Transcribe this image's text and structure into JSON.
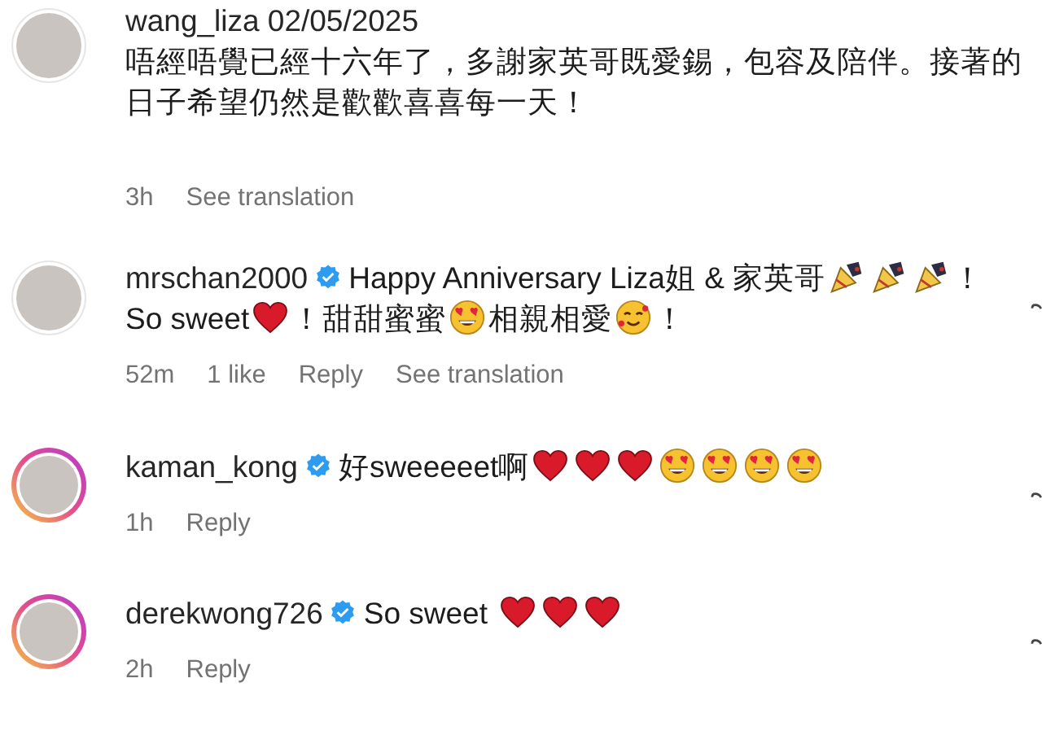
{
  "comments": [
    {
      "username": "wang_liza",
      "verified": false,
      "story_ring": false,
      "date": "02/05/2025",
      "show_like": false,
      "parts": [
        {
          "kind": "text",
          "text": "唔經唔覺已經十六年了，多謝家英哥既愛錫，包容及陪伴。接著的日子希望仍然是歡歡喜喜每一天！"
        }
      ],
      "meta": [
        "3h",
        "See translation"
      ]
    },
    {
      "username": "mrschan2000",
      "verified": true,
      "story_ring": false,
      "show_like": true,
      "parts": [
        {
          "kind": "text",
          "text": "Happy Anniversary Liza姐 & 家英哥"
        },
        {
          "kind": "popper"
        },
        {
          "kind": "popper"
        },
        {
          "kind": "popper"
        },
        {
          "kind": "text",
          "text": "！So sweet"
        },
        {
          "kind": "heart"
        },
        {
          "kind": "text",
          "text": "！甜甜蜜蜜"
        },
        {
          "kind": "heart-eyes"
        },
        {
          "kind": "text",
          "text": "相親相愛"
        },
        {
          "kind": "smile-hearts"
        },
        {
          "kind": "text",
          "text": "！"
        }
      ],
      "meta": [
        "52m",
        "1 like",
        "Reply",
        "See translation"
      ]
    },
    {
      "username": "kaman_kong",
      "verified": true,
      "story_ring": true,
      "show_like": true,
      "parts": [
        {
          "kind": "text",
          "text": "好sweeeeet啊"
        },
        {
          "kind": "heart"
        },
        {
          "kind": "heart"
        },
        {
          "kind": "heart"
        },
        {
          "kind": "heart-eyes"
        },
        {
          "kind": "heart-eyes"
        },
        {
          "kind": "heart-eyes"
        },
        {
          "kind": "heart-eyes"
        }
      ],
      "meta": [
        "1h",
        "Reply"
      ]
    },
    {
      "username": "derekwong726",
      "verified": true,
      "story_ring": true,
      "show_like": true,
      "parts": [
        {
          "kind": "text",
          "text": "So sweet "
        },
        {
          "kind": "heart"
        },
        {
          "kind": "heart"
        },
        {
          "kind": "heart"
        }
      ],
      "meta": [
        "2h",
        "Reply"
      ]
    }
  ]
}
